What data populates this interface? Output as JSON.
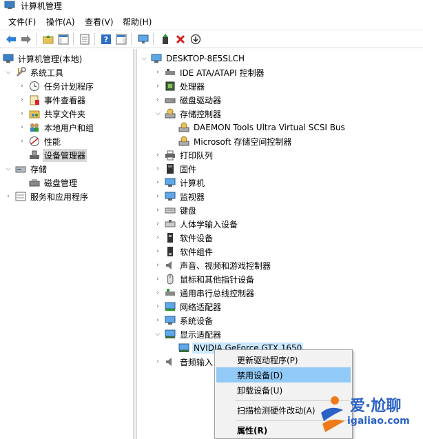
{
  "window": {
    "title": "计算机管理"
  },
  "menu": [
    "文件(F)",
    "操作(A)",
    "查看(V)",
    "帮助(H)"
  ],
  "toolbar": {
    "icons": [
      "back-arrow-icon",
      "forward-arrow-icon",
      "up-folder-icon",
      "show-tree-icon",
      "properties-icon",
      "help-icon",
      "action-pane-icon",
      "monitor-icon",
      "update-driver-icon",
      "uninstall-icon",
      "disable-icon"
    ]
  },
  "left_tree": {
    "root": "计算机管理(本地)",
    "system_tools": "系统工具",
    "task_scheduler": "任务计划程序",
    "event_viewer": "事件查看器",
    "shared_folders": "共享文件夹",
    "local_users": "本地用户和组",
    "performance": "性能",
    "device_manager": "设备管理器",
    "storage": "存储",
    "disk_management": "磁盘管理",
    "services": "服务和应用程序"
  },
  "device_tree": {
    "computer": "DESKTOP-8E5SLCH",
    "categories": [
      "IDE ATA/ATAPI 控制器",
      "处理器",
      "磁盘驱动器",
      "存储控制器",
      "打印队列",
      "固件",
      "计算机",
      "监视器",
      "键盘",
      "人体学输入设备",
      "软件设备",
      "软件组件",
      "声音、视频和游戏控制器",
      "鼠标和其他指针设备",
      "通用串行总线控制器",
      "网络适配器",
      "系统设备",
      "显示适配器",
      "音频输入"
    ],
    "storage_children": [
      "DAEMON Tools Ultra Virtual SCSI Bus",
      "Microsoft 存储空间控制器"
    ],
    "display_child": "NVIDIA GeForce GTX 1650"
  },
  "context_menu": {
    "update_driver": "更新驱动程序(P)",
    "disable_device": "禁用设备(D)",
    "uninstall_device": "卸载设备(U)",
    "scan_hardware": "扫描检测硬件改动(A)",
    "properties": "属性(R)"
  },
  "watermark": {
    "title": "爱·尬聊",
    "url": "igaliao.com"
  }
}
